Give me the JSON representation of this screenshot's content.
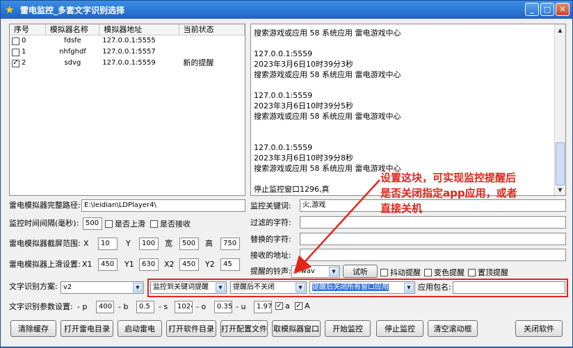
{
  "window": {
    "title": "雷电监控_多套文字识别选择",
    "min": "_",
    "max": "□",
    "close": "✕"
  },
  "list": {
    "headers": [
      "序号",
      "模拟器名称",
      "模拟器地址",
      "当前状态"
    ],
    "rows": [
      {
        "index": "0",
        "name": "fdsfe",
        "addr": "127.0.0.1:5555",
        "status": "",
        "checked": false
      },
      {
        "index": "1",
        "name": "nhfghdf",
        "addr": "127.0.0.1:5557",
        "status": "",
        "checked": false
      },
      {
        "index": "2",
        "name": "sdvg",
        "addr": "127.0.0.1:5559",
        "status": "新的提醒",
        "checked": true
      }
    ]
  },
  "log": {
    "lines": [
      "搜索游戏或应用 58 系统应用 雷电游戏中心",
      "",
      "127.0.0.1:5559",
      "2023年3月6日10时39分3秒",
      "搜索游戏或应用 58 系统应用 雷电游戏中心",
      "",
      "127.0.0.1:5559",
      "2023年3月6日10时39分5秒",
      "搜索游戏或应用 58 系统应用 雷电游戏中心",
      "",
      "",
      "127.0.0.1:5559",
      "2023年3月6日10时39分8秒",
      "搜索游戏或应用 58 系统应用 雷电游戏中心",
      "",
      "停止监控窗口1296,真"
    ]
  },
  "form": {
    "path_label": "雷电模拟器完整路径:",
    "path_value": "E:\\leidian\\LDPlayer4\\",
    "interval_label": "监控时间间隔(毫秒):",
    "interval_value": "500",
    "slide_up_label": "是否上滑",
    "receive_label": "是否接收",
    "capture_label": "雷电模拟器截屏范围:",
    "capture": {
      "x_label": "X",
      "x": "10",
      "y_label": "Y",
      "y": "100",
      "w_label": "宽",
      "w": "500",
      "h_label": "高",
      "h": "750"
    },
    "swipe_label": "雷电模拟器上滑设置:",
    "swipe": {
      "x1_label": "X1",
      "x1": "450",
      "y1_label": "Y1",
      "y1": "630",
      "x2_label": "X2",
      "x2": "450",
      "y2_label": "Y2",
      "y2": "45"
    },
    "ocr_label": "文字识别方案:",
    "ocr_value": "v2",
    "ocr_param_label": "文字识别参数设置:",
    "ocr_params": {
      "p_label": "- p",
      "p": "400",
      "b_label": "- b",
      "b": "0.5",
      "s_label": "- s",
      "s": "1024",
      "o_label": "- o",
      "o": "0.35",
      "u_label": "- u",
      "u": "1.97",
      "a_label": "a",
      "A_label": "A"
    },
    "keyword_label": "监控关键词:",
    "keyword_value": "火,游戏",
    "filter_label": "过滤的字符:",
    "replace_label": "替换的字符:",
    "receive_addr_label": "接收的地址:",
    "ringtone_label": "提醒的铃声:",
    "ringtone_value": "9.wav",
    "test_button": "试听",
    "shake_label": "抖动提醒",
    "color_label": "变色提醒",
    "top_label": "置顶提醒",
    "mode1": "监控到关键词提醒",
    "mode2": "提醒后不关闭",
    "mode3": "提醒后关闭所有窗口应用",
    "package_label": "应用包名:"
  },
  "buttons": [
    "清除缓存",
    "打开雷电目录",
    "启动雷电",
    "打开软件目录",
    "打开配置文件",
    "取模拟器窗口",
    "开始监控",
    "停止监控",
    "清空滚动框",
    "关闭软件"
  ],
  "annotation": {
    "line1": "设置这块，可实现监控提醒后",
    "line2": "是否关闭指定app应用，或者",
    "line3": "直接关机",
    "color": "#e0261b"
  }
}
